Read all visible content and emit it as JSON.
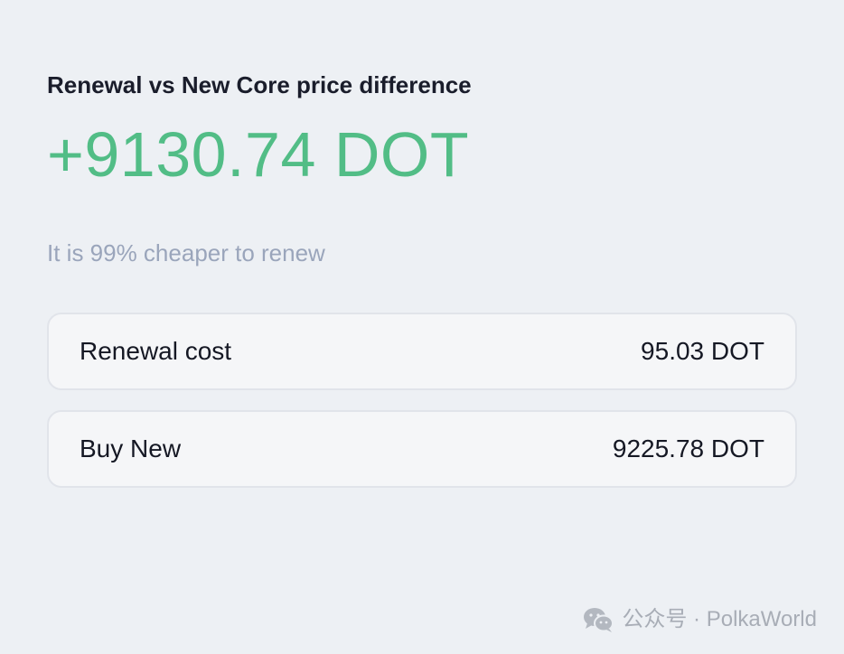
{
  "header": {
    "title": "Renewal vs New Core price difference"
  },
  "difference": {
    "value": "+9130.74 DOT"
  },
  "hint": {
    "text": "It is 99% cheaper to renew"
  },
  "rows": [
    {
      "label": "Renewal cost",
      "value": "95.03 DOT"
    },
    {
      "label": "Buy New",
      "value": "9225.78 DOT"
    }
  ],
  "watermark": {
    "icon": "wechat-icon",
    "text": "公众号 · PolkaWorld"
  },
  "colors": {
    "background": "#edf0f4",
    "accent_positive": "#52bd86",
    "muted_text": "#9aa5bb",
    "row_background": "#f5f6f8",
    "row_border": "#e1e4ea"
  }
}
